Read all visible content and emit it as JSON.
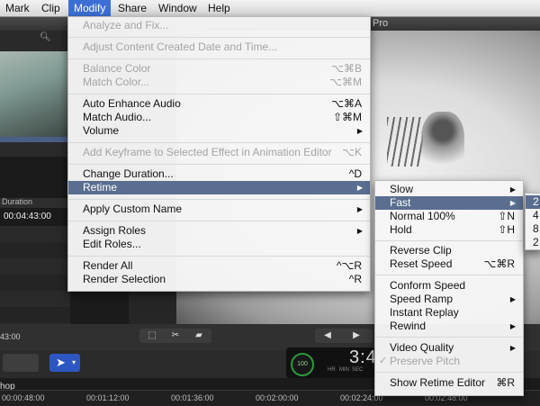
{
  "menubar": {
    "items": [
      {
        "label": "Mark"
      },
      {
        "label": "Clip"
      },
      {
        "label": "Modify"
      },
      {
        "label": "Share"
      },
      {
        "label": "Window"
      },
      {
        "label": "Help"
      }
    ]
  },
  "app": {
    "title_fragment": "Pro",
    "duration_header": "Duration",
    "duration_value": "00:04:43:00",
    "timecode_small": "43:00",
    "dial_value": "100",
    "timecode_big": "3:4",
    "timecode_units": {
      "hr": "HR",
      "min": "MIN",
      "sec": "SEC"
    },
    "timeline_label": "hop",
    "ruler_ticks": [
      "00:00:48:00",
      "00:01:12:00",
      "00:01:36:00",
      "00:02:00:00",
      "00:02:24:00",
      "00:02:48:00"
    ]
  },
  "modify_menu": {
    "analyze": {
      "label": "Analyze and Fix..."
    },
    "adjust_date": {
      "label": "Adjust Content Created Date and Time..."
    },
    "balance_color": {
      "label": "Balance Color",
      "shortcut": "⌥⌘B"
    },
    "match_color": {
      "label": "Match Color...",
      "shortcut": "⌥⌘M"
    },
    "auto_enhance_audio": {
      "label": "Auto Enhance Audio",
      "shortcut": "⌥⌘A"
    },
    "match_audio": {
      "label": "Match Audio...",
      "shortcut": "⇧⌘M"
    },
    "volume": {
      "label": "Volume"
    },
    "add_keyframe": {
      "label": "Add Keyframe to Selected Effect in Animation Editor",
      "shortcut": "⌥K"
    },
    "change_duration": {
      "label": "Change Duration...",
      "shortcut": "^D"
    },
    "retime": {
      "label": "Retime"
    },
    "apply_custom_name": {
      "label": "Apply Custom Name"
    },
    "assign_roles": {
      "label": "Assign Roles"
    },
    "edit_roles": {
      "label": "Edit Roles..."
    },
    "render_all": {
      "label": "Render All",
      "shortcut": "^⌥R"
    },
    "render_selection": {
      "label": "Render Selection",
      "shortcut": "^R"
    }
  },
  "retime_menu": {
    "slow": {
      "label": "Slow"
    },
    "fast": {
      "label": "Fast"
    },
    "normal": {
      "label": "Normal 100%",
      "shortcut": "⇧N"
    },
    "hold": {
      "label": "Hold",
      "shortcut": "⇧H"
    },
    "reverse_clip": {
      "label": "Reverse Clip"
    },
    "reset_speed": {
      "label": "Reset Speed",
      "shortcut": "⌥⌘R"
    },
    "conform_speed": {
      "label": "Conform Speed"
    },
    "speed_ramp": {
      "label": "Speed Ramp"
    },
    "instant_replay": {
      "label": "Instant Replay"
    },
    "rewind": {
      "label": "Rewind"
    },
    "video_quality": {
      "label": "Video Quality"
    },
    "preserve_pitch": {
      "label": "Preserve Pitch"
    },
    "show_retime_editor": {
      "label": "Show Retime Editor",
      "shortcut": "⌘R"
    }
  },
  "fast_menu": {
    "items": [
      {
        "label": "2"
      },
      {
        "label": "4"
      },
      {
        "label": "8"
      },
      {
        "label": "2"
      }
    ]
  },
  "colors": {
    "menu_highlight": "#5a6e90",
    "menubar_active": "#3b6fd6",
    "disabled_text": "#a4a4a4"
  }
}
